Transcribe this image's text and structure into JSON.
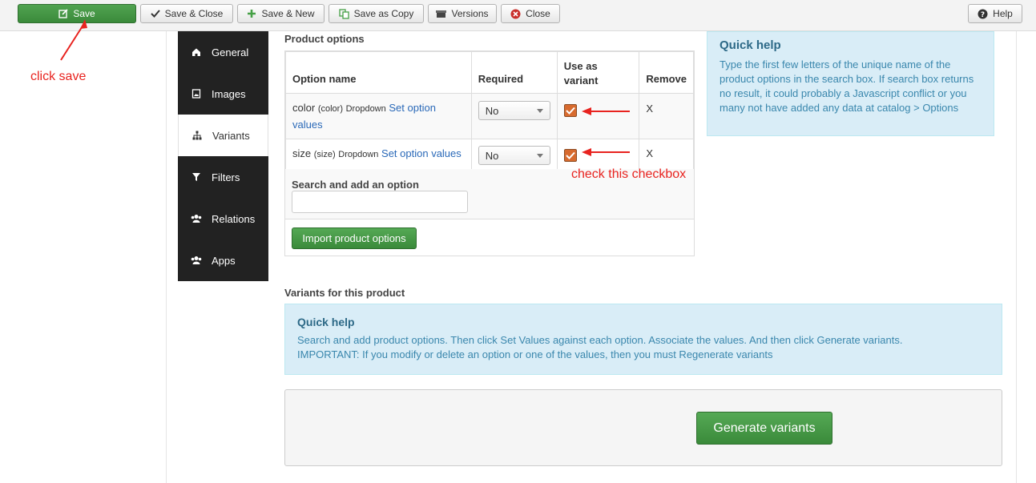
{
  "toolbar": {
    "save": "Save",
    "save_close": "Save & Close",
    "save_new": "Save & New",
    "save_copy": "Save as Copy",
    "versions": "Versions",
    "close": "Close",
    "help": "Help"
  },
  "sidenav": {
    "items": [
      {
        "label": "General",
        "icon": "home-icon",
        "active": false
      },
      {
        "label": "Images",
        "icon": "image-icon",
        "active": false
      },
      {
        "label": "Variants",
        "icon": "sitemap-icon",
        "active": true
      },
      {
        "label": "Filters",
        "icon": "filter-icon",
        "active": false
      },
      {
        "label": "Relations",
        "icon": "users-icon",
        "active": false
      },
      {
        "label": "Apps",
        "icon": "users-icon",
        "active": false
      }
    ]
  },
  "options": {
    "title": "Product options",
    "headers": [
      "Option name",
      "Required",
      "Use as variant",
      "Remove"
    ],
    "rows": [
      {
        "name": "color",
        "code": "(color)",
        "type": "Dropdown",
        "link": "Set option values",
        "required": "No",
        "variant": true,
        "remove": "X"
      },
      {
        "name": "size",
        "code": "(size)",
        "type": "Dropdown",
        "link": "Set option values",
        "required": "No",
        "variant": true,
        "remove": "X"
      }
    ],
    "search_label": "Search and add an option",
    "search_value": "",
    "import_button": "Import product options"
  },
  "quick_help_top": {
    "title": "Quick help",
    "text": "Type the first few letters of the unique name of the product options in the search box. If search box returns no result, it could probably a Javascript conflict or you many not have added any data at catalog > Options"
  },
  "variants": {
    "title": "Variants for this product",
    "help_title": "Quick help",
    "help_line1": "Search and add product options. Then click Set Values against each option. Associate the values. And then click Generate variants.",
    "help_line2": "IMPORTANT: If you modify or delete an option or one of the values, then you must Regenerate variants",
    "generate_button": "Generate variants"
  },
  "annotations": {
    "click_save": "click save",
    "check_checkbox": "check this checkbox",
    "color": "#e8231f"
  },
  "colors": {
    "save_green": "#46a046",
    "nav_dark": "#222222",
    "help_blue_bg": "#d9edf7",
    "checkbox_orange": "#d76a2e"
  }
}
